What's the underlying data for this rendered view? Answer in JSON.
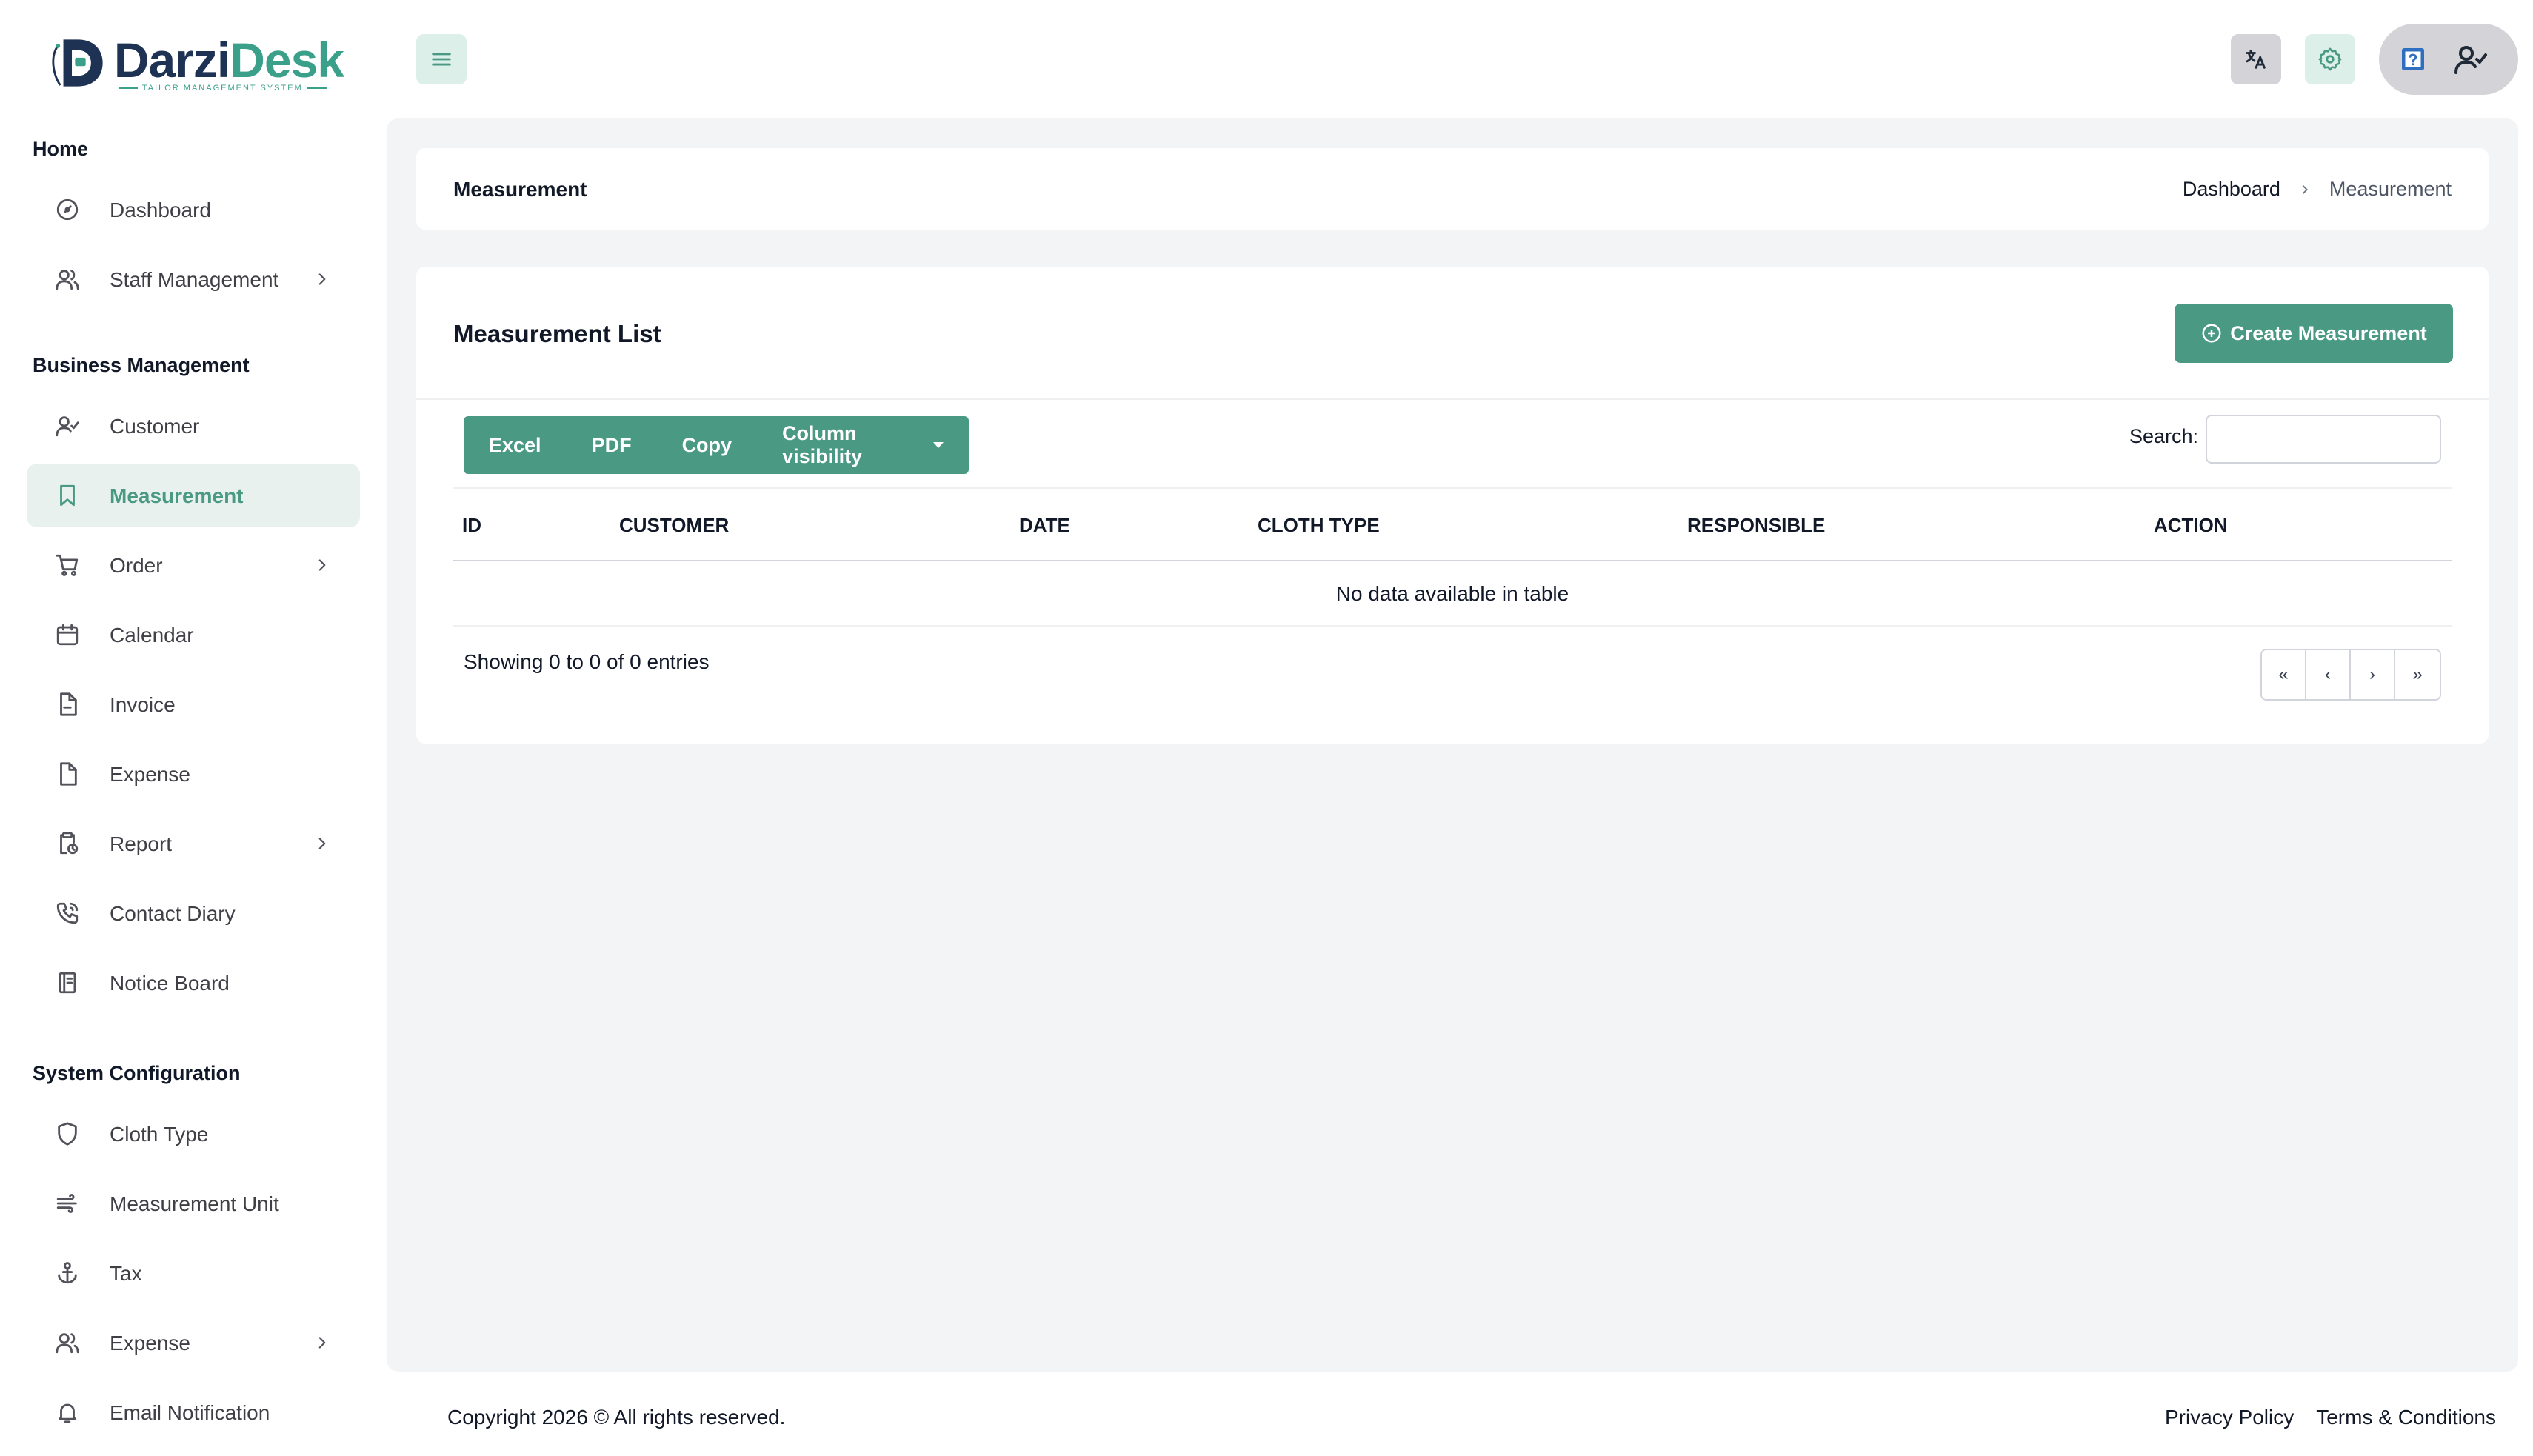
{
  "brand": {
    "name_part1": "Darzi",
    "name_part2": "Desk",
    "tagline": "TAILOR MANAGEMENT SYSTEM"
  },
  "sidebar": {
    "sections": [
      {
        "title": "Home"
      },
      {
        "title": "Business Management"
      },
      {
        "title": "System Configuration"
      }
    ],
    "items": [
      {
        "label": "Dashboard",
        "icon": "gauge-icon"
      },
      {
        "label": "Staff Management",
        "icon": "users-icon",
        "has_submenu": true
      },
      {
        "label": "Customer",
        "icon": "user-check-icon"
      },
      {
        "label": "Measurement",
        "icon": "bookmark-icon",
        "active": true
      },
      {
        "label": "Order",
        "icon": "cart-icon",
        "has_submenu": true
      },
      {
        "label": "Calendar",
        "icon": "calendar-icon"
      },
      {
        "label": "Invoice",
        "icon": "file-minus-icon"
      },
      {
        "label": "Expense",
        "icon": "file-icon"
      },
      {
        "label": "Report",
        "icon": "clipboard-clock-icon",
        "has_submenu": true
      },
      {
        "label": "Contact Diary",
        "icon": "phone-icon"
      },
      {
        "label": "Notice Board",
        "icon": "notebook-icon"
      },
      {
        "label": "Cloth Type",
        "icon": "shield-icon"
      },
      {
        "label": "Measurement Unit",
        "icon": "wind-icon"
      },
      {
        "label": "Tax",
        "icon": "anchor-icon"
      },
      {
        "label": "Expense",
        "icon": "users-icon",
        "has_submenu": true
      },
      {
        "label": "Email Notification",
        "icon": "bell-icon"
      }
    ]
  },
  "topbar": {
    "menu_icon": "hamburger-icon",
    "translate_icon": "translate-icon",
    "settings_icon": "gear-icon",
    "help_icon": "help-icon",
    "user_icon": "user-check-icon"
  },
  "page": {
    "title": "Measurement",
    "breadcrumb": {
      "home": "Dashboard",
      "current": "Measurement"
    }
  },
  "list": {
    "title": "Measurement List",
    "create_label": "Create Measurement",
    "export_buttons": [
      "Excel",
      "PDF",
      "Copy",
      "Column visibility"
    ],
    "search_label": "Search:",
    "search_value": "",
    "columns": [
      "ID",
      "CUSTOMER",
      "DATE",
      "CLOTH TYPE",
      "RESPONSIBLE",
      "ACTION"
    ],
    "rows": [],
    "empty_message": "No data available in table",
    "info": "Showing 0 to 0 of 0 entries",
    "pager": [
      "«",
      "‹",
      "›",
      "»"
    ]
  },
  "footer": {
    "copyright": "Copyright 2026 © All rights reserved.",
    "links": [
      "Privacy Policy",
      "Terms & Conditions"
    ]
  },
  "colors": {
    "accent": "#4a9a83",
    "accent_light": "#dcefe9",
    "navy": "#1e3354",
    "background": "#f3f4f6"
  }
}
